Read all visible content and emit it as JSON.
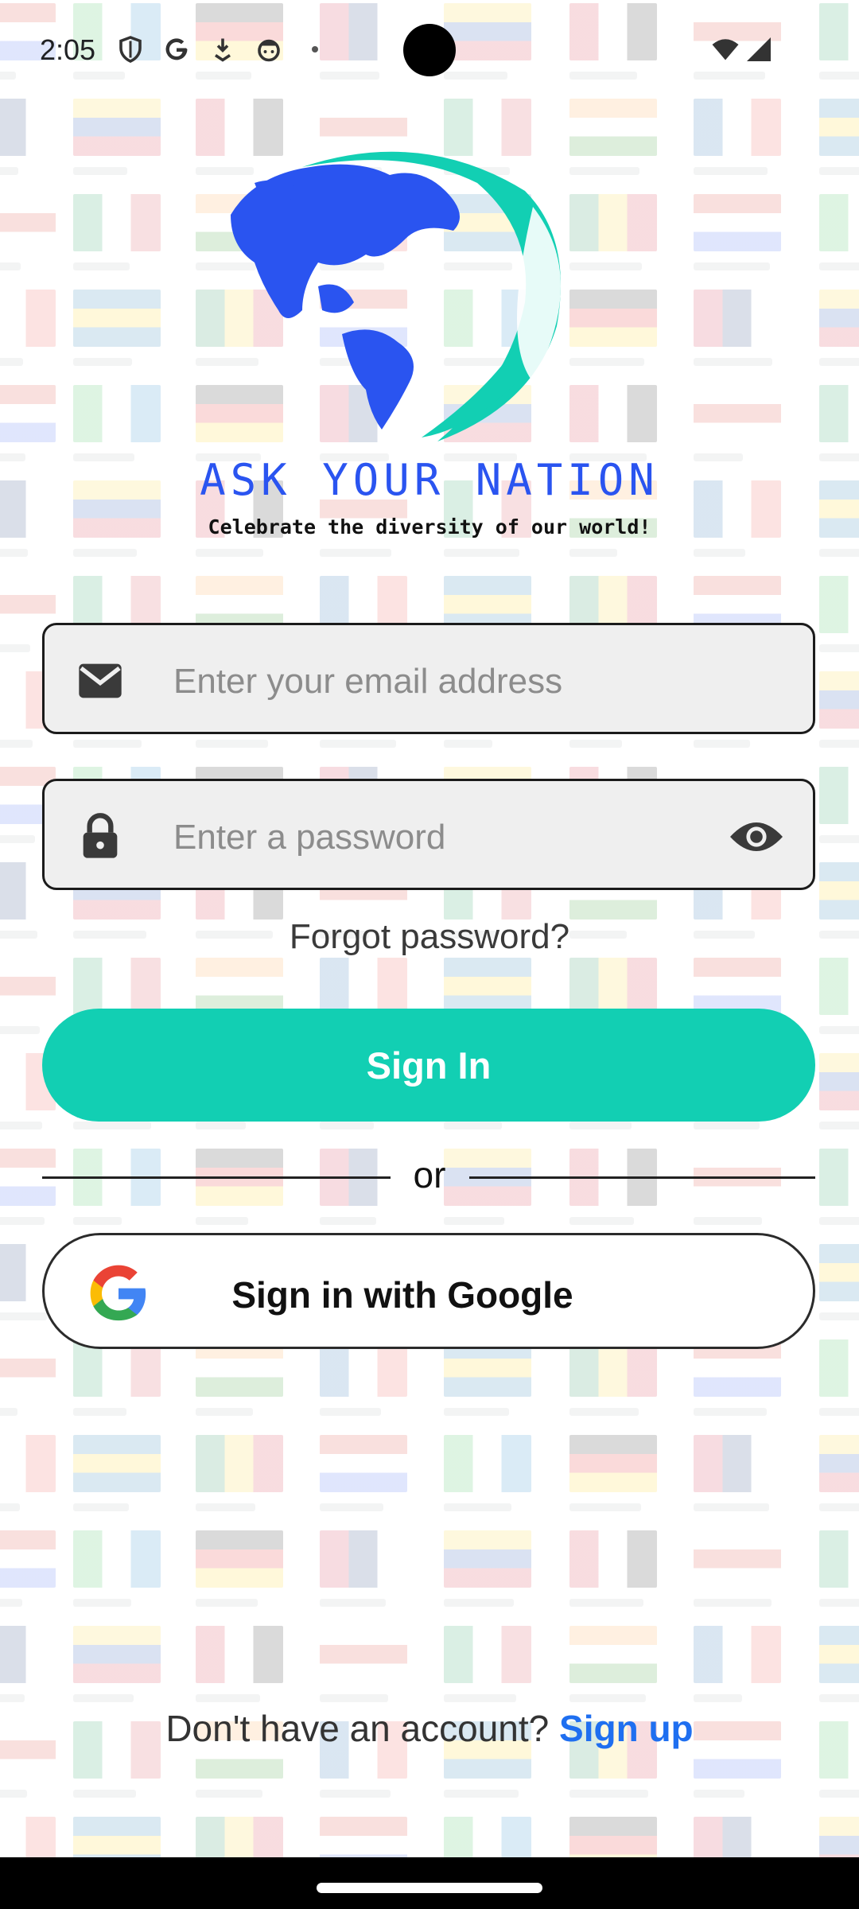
{
  "status_bar": {
    "time": "2:05",
    "icons": [
      "shield-icon",
      "google-g-icon",
      "download-icon",
      "face-icon",
      "dot-icon",
      "wifi-icon",
      "signal-icon"
    ]
  },
  "brand": {
    "title": "ASK YOUR NATION",
    "tagline": "Celebrate the diversity of our world!",
    "colors": {
      "globe": "#2a54f0",
      "leaf": "#12cfb3"
    }
  },
  "login": {
    "email_placeholder": "Enter your email address",
    "email_value": "",
    "password_placeholder": "Enter a password",
    "password_value": "",
    "forgot_label": "Forgot password?",
    "signin_label": "Sign In",
    "divider_label": "or",
    "google_label": "Sign in with Google",
    "signup_prompt": "Don't have an account?",
    "signup_link": "Sign up"
  },
  "theme": {
    "accent": "#12cfb3",
    "link": "#1f6ff0",
    "field_bg": "#efefef"
  }
}
